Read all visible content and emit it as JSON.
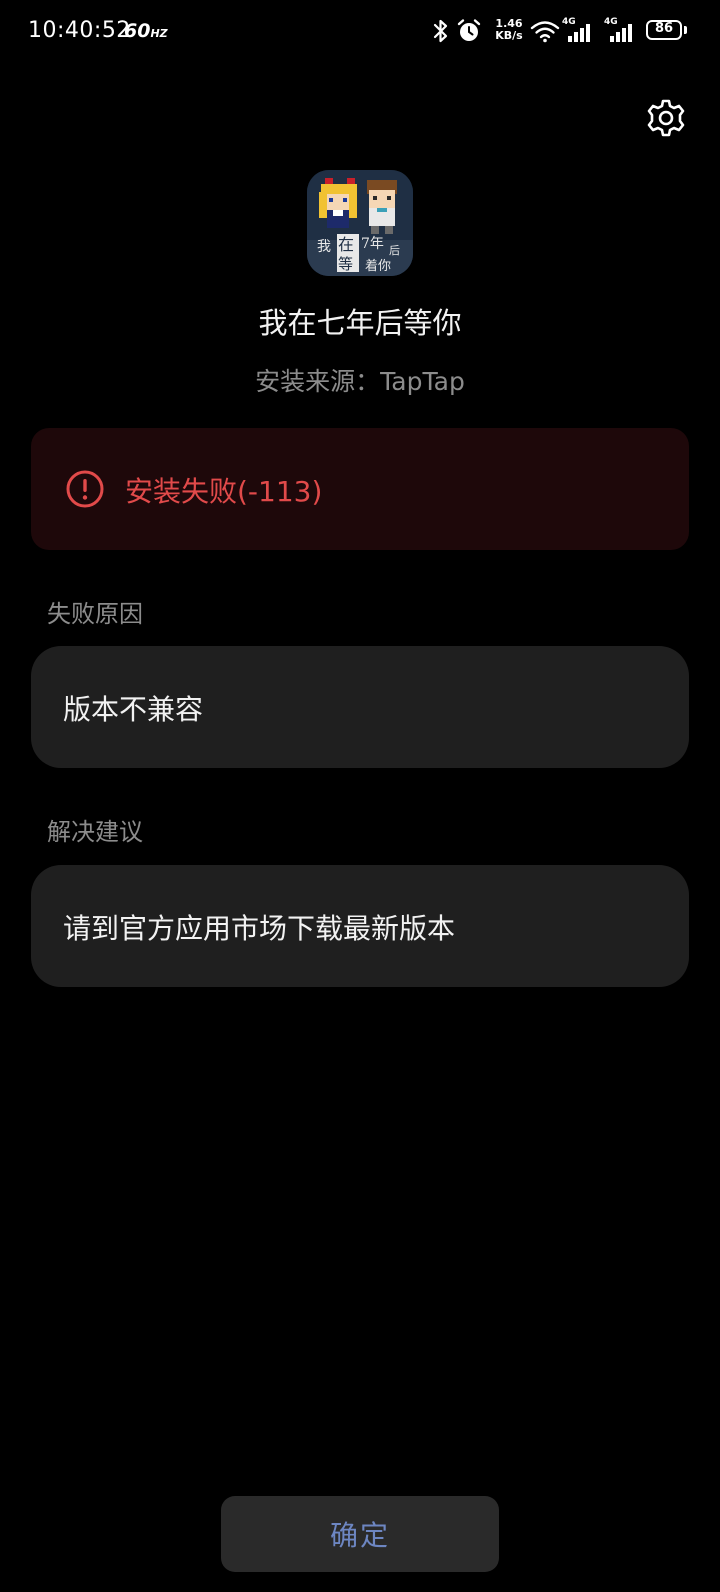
{
  "status_bar": {
    "time": "10:40:52",
    "refresh_rate": "60",
    "refresh_unit": "HZ",
    "net_speed_value": "1.46",
    "net_speed_unit": "KB/s",
    "network_type_1": "4G",
    "network_type_2": "4G",
    "battery_level": "86",
    "icons": [
      "bluetooth-icon",
      "alarm-icon",
      "wifi-icon",
      "signal-icon",
      "signal-icon",
      "battery-icon"
    ]
  },
  "header": {
    "settings_icon": "gear-icon"
  },
  "app": {
    "name": "我在七年后等你",
    "install_source": "安装来源：TapTap",
    "icon_label_1": "我",
    "icon_label_2": "在",
    "icon_label_3": "7年",
    "icon_label_4": "后",
    "icon_label_5": "等",
    "icon_label_6": "着你"
  },
  "error": {
    "icon": "exclamation-circle-icon",
    "message": "安装失败(-113)",
    "color": "#e14a4a"
  },
  "failure_reason": {
    "label": "失败原因",
    "text": "版本不兼容"
  },
  "suggestion": {
    "label": "解决建议",
    "text": "请到官方应用市场下载最新版本"
  },
  "actions": {
    "confirm_label": "确定",
    "confirm_color": "#6d86c2"
  }
}
